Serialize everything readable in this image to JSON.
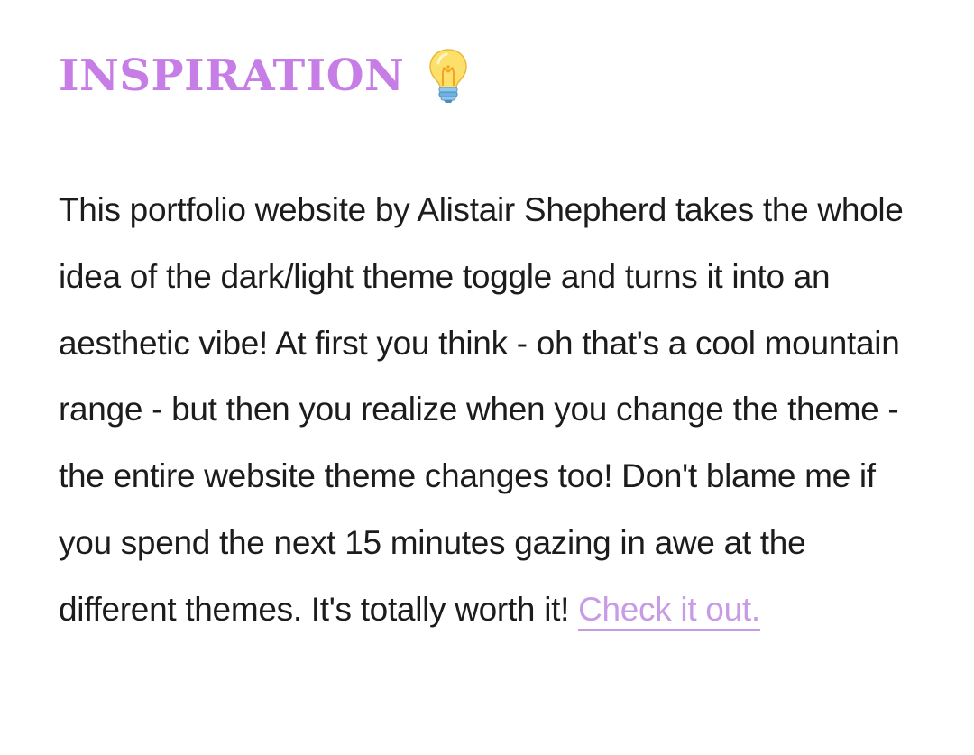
{
  "heading": {
    "text": "INSPIRATION",
    "icon": "lightbulb-icon"
  },
  "paragraph": {
    "text": "This portfolio website by Alistair Shepherd takes the whole idea of the dark/light theme toggle and turns it into an aesthetic vibe! At first you think - oh that's a cool mountain range - but then you realize when you change the theme - the entire website theme changes too! Don't blame me if you spend the next 15 minutes gazing in awe at the different themes. It's totally worth it!",
    "link_text": "Check it out."
  },
  "colors": {
    "heading": "#c77de6",
    "link": "#c79be6",
    "body_text": "#1c1c1c",
    "background": "#ffffff"
  }
}
